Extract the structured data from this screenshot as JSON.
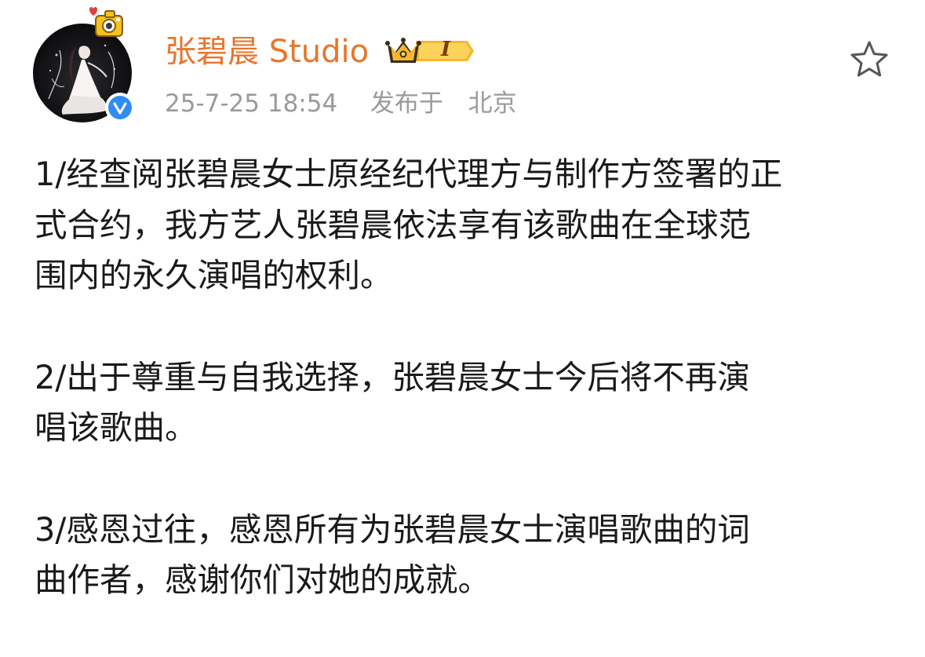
{
  "post": {
    "author": {
      "name": "张碧晨 Studio",
      "verified": true,
      "member_level": "I",
      "avatar_icon": "avatar-illustration"
    },
    "meta": {
      "date": "25-7-25",
      "time": "18:54",
      "published_label": "发布于",
      "location": "北京"
    },
    "actions": {
      "favorite_icon": "star-outline-icon"
    },
    "paragraphs": [
      {
        "lines": [
          "1/经查阅张碧晨女士原经纪代理方与制作方签署的正",
          "式合约，我方艺人张碧晨依法享有该歌曲在全球范",
          "围内的永久演唱的权利。"
        ]
      },
      {
        "lines": [
          "2/出于尊重与自我选择，张碧晨女士今后将不再演",
          "唱该歌曲。"
        ]
      },
      {
        "lines": [
          "3/感恩过往，感恩所有为张碧晨女士演唱歌曲的词",
          "曲作者，感谢你们对她的成就。"
        ]
      }
    ]
  },
  "colors": {
    "username": "#e8762c",
    "meta_text": "#9a9a9a",
    "body_text": "#1a1a1a",
    "verified_blue": "#2f8cf0",
    "badge_gold": "#f5b82e"
  }
}
